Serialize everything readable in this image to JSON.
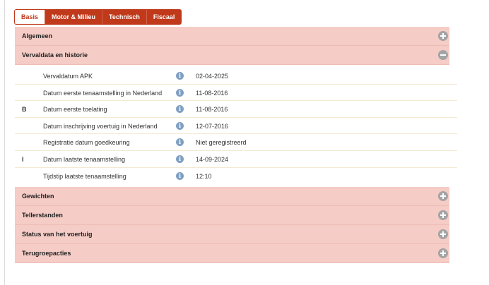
{
  "tabs": [
    {
      "label": "Basis",
      "active": true
    },
    {
      "label": "Motor & Milieu",
      "active": false
    },
    {
      "label": "Technisch",
      "active": false
    },
    {
      "label": "Fiscaal",
      "active": false
    }
  ],
  "sections_top": [
    {
      "title": "Algemeen",
      "expanded": false
    }
  ],
  "expanded_section": {
    "title": "Vervaldata en historie",
    "expanded": true,
    "info_icon": "i",
    "rows": [
      {
        "code": "",
        "label": "Vervaldatum APK",
        "value": "02-04-2025"
      },
      {
        "code": "",
        "label": "Datum eerste tenaamstelling in Nederland",
        "value": "11-08-2016"
      },
      {
        "code": "B",
        "label": "Datum eerste toelating",
        "value": "11-08-2016"
      },
      {
        "code": "",
        "label": "Datum inschrijving voertuig in Nederland",
        "value": "12-07-2016"
      },
      {
        "code": "",
        "label": "Registratie datum goedkeuring",
        "value": "Niet geregistreerd"
      },
      {
        "code": "I",
        "label": "Datum laatste tenaamstelling",
        "value": "14-09-2024"
      },
      {
        "code": "",
        "label": "Tijdstip laatste tenaamstelling",
        "value": "12:10"
      }
    ]
  },
  "sections_bottom": [
    {
      "title": "Gewichten",
      "expanded": false
    },
    {
      "title": "Tellerstanden",
      "expanded": false
    },
    {
      "title": "Status van het voertuig",
      "expanded": false
    },
    {
      "title": "Terugroepacties",
      "expanded": false
    }
  ],
  "colors": {
    "accent": "#c0391b",
    "section_bg": "#f5ccc6",
    "info_icon": "#7fa0c3",
    "toggle_icon": "#a4a4a4"
  }
}
